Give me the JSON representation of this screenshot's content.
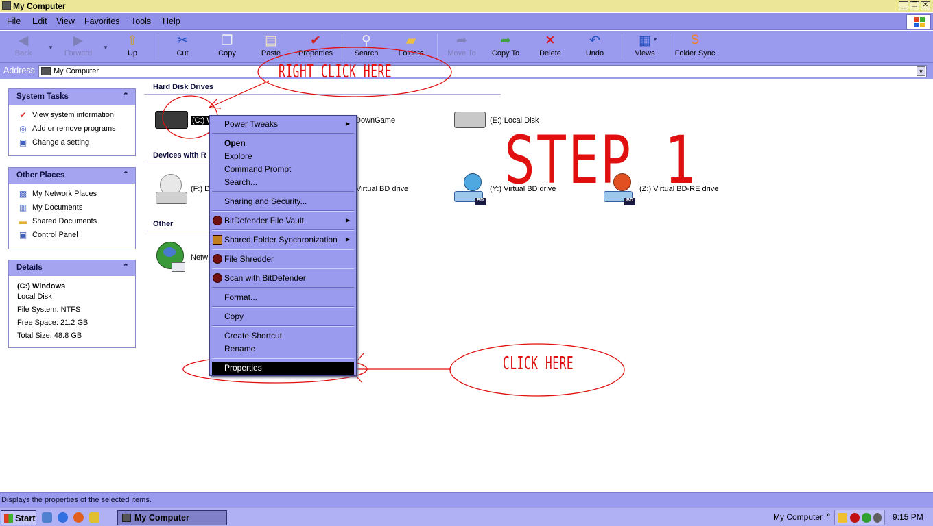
{
  "window": {
    "title": "My Computer",
    "buttons": {
      "minimize": "_",
      "maximize": "❐",
      "close": "✕"
    }
  },
  "menubar": {
    "items": [
      "File",
      "Edit",
      "View",
      "Favorites",
      "Tools",
      "Help"
    ]
  },
  "toolbar": {
    "back": "Back",
    "forward": "Forward",
    "up": "Up",
    "cut": "Cut",
    "copy": "Copy",
    "paste": "Paste",
    "properties": "Properties",
    "search": "Search",
    "folders": "Folders",
    "move_to": "Move To",
    "copy_to": "Copy To",
    "delete": "Delete",
    "undo": "Undo",
    "views": "Views",
    "folder_sync": "Folder Sync"
  },
  "address": {
    "label": "Address",
    "value": "My Computer"
  },
  "sidebar": {
    "system_tasks": {
      "title": "System Tasks",
      "items": [
        "View system information",
        "Add or remove programs",
        "Change a setting"
      ]
    },
    "other_places": {
      "title": "Other Places",
      "items": [
        "My Network Places",
        "My Documents",
        "Shared Documents",
        "Control Panel"
      ]
    },
    "details": {
      "title": "Details",
      "name": "(C:) Windows",
      "type": "Local Disk",
      "file_system": "File System: NTFS",
      "free_space": "Free Space: 21.2 GB",
      "total_size": "Total Size: 48.8 GB"
    }
  },
  "main": {
    "groups": {
      "hard_disk": "Hard Disk Drives",
      "removable": "Devices with R",
      "other": "Other"
    },
    "drives": {
      "c": "(C:) W",
      "d": "DownGame",
      "e": "(E:) Local Disk",
      "f": "(F:) D",
      "x": "Virtual BD drive",
      "y": "(Y:) Virtual BD drive",
      "z": "(Z:) Virtual BD-RE drive",
      "network": "Netw"
    }
  },
  "context_menu": {
    "power_tweaks": "Power Tweaks",
    "open": "Open",
    "explore": "Explore",
    "command_prompt": "Command Prompt",
    "search": "Search...",
    "sharing": "Sharing and Security...",
    "bitdefender_vault": "BitDefender File Vault",
    "shared_sync": "Shared Folder Synchronization",
    "file_shredder": "File Shredder",
    "scan": "Scan with BitDefender",
    "format": "Format...",
    "copy": "Copy",
    "create_shortcut": "Create Shortcut",
    "rename": "Rename",
    "properties": "Properties"
  },
  "annotations": {
    "right_click": "RIGHT CLICK HERE",
    "step": "STEP 1",
    "click_here": "CLICK HERE"
  },
  "statusbar": {
    "text": "Displays the properties of the selected items."
  },
  "taskbar": {
    "start": "Start",
    "active_window": "My Computer",
    "tray_label": "My Computer",
    "clock": "9:15 PM"
  },
  "colors": {
    "annotation": "#e01010",
    "menubar": "#9090e8",
    "titlebar": "#ece699"
  }
}
